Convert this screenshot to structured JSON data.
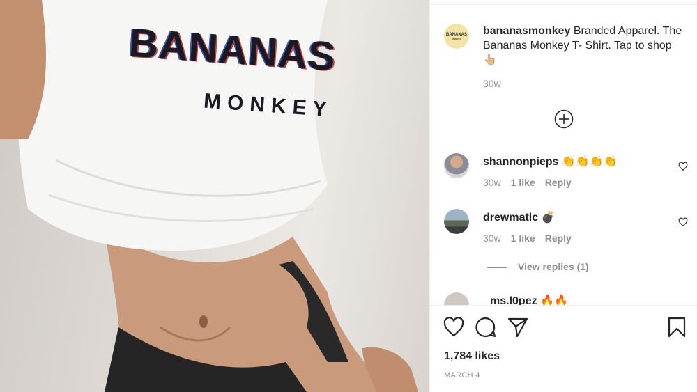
{
  "post": {
    "image_alt": "Woman wearing cropped white Bananas Monkey t-shirt",
    "shirt_text_top": "BANANAS",
    "shirt_text_bottom": "MONKEY"
  },
  "caption": {
    "avatar_text": "BANANAS",
    "avatar_subtext": "MONKEY",
    "username": "bananasmonkey",
    "text": " Branded Apparel. The Bananas Monkey T- Shirt. Tap to shop👆🏼",
    "time": "30w"
  },
  "comments": [
    {
      "username": "shannonpieps",
      "text": " 👏👏👏👏",
      "time": "30w",
      "likes": "1 like",
      "reply": "Reply"
    },
    {
      "username": "drewmatlc",
      "text": " 💣",
      "time": "30w",
      "likes": "1 like",
      "reply": "Reply"
    },
    {
      "username": "ms.l0pez",
      "text": "  🔥🔥"
    }
  ],
  "view_replies": "View replies (1)",
  "likes": "1,784 likes",
  "date": "MARCH 4",
  "icons": [
    "add-comment-icon",
    "heart-icon",
    "comment-icon",
    "share-icon",
    "bookmark-icon"
  ]
}
